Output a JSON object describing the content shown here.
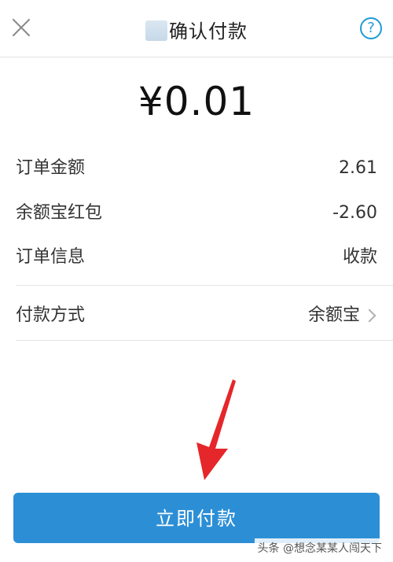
{
  "header": {
    "title": "确认付款",
    "help_icon_glyph": "?"
  },
  "amount": "¥0.01",
  "details": [
    {
      "label": "订单金额",
      "value": "2.61"
    },
    {
      "label": "余额宝红包",
      "value": "-2.60"
    },
    {
      "label": "订单信息",
      "value": "收款"
    }
  ],
  "payment_method": {
    "label": "付款方式",
    "value": "余额宝"
  },
  "pay_button_label": "立即付款",
  "watermark": "头条 @想念某某人闯天下",
  "colors": {
    "primary_button": "#2c8fd6",
    "help_icon": "#1d9bd7",
    "annotation_arrow": "#e5262a"
  },
  "icons": [
    "close-icon",
    "help-icon",
    "chevron-right-icon",
    "annotation-arrow-icon"
  ]
}
